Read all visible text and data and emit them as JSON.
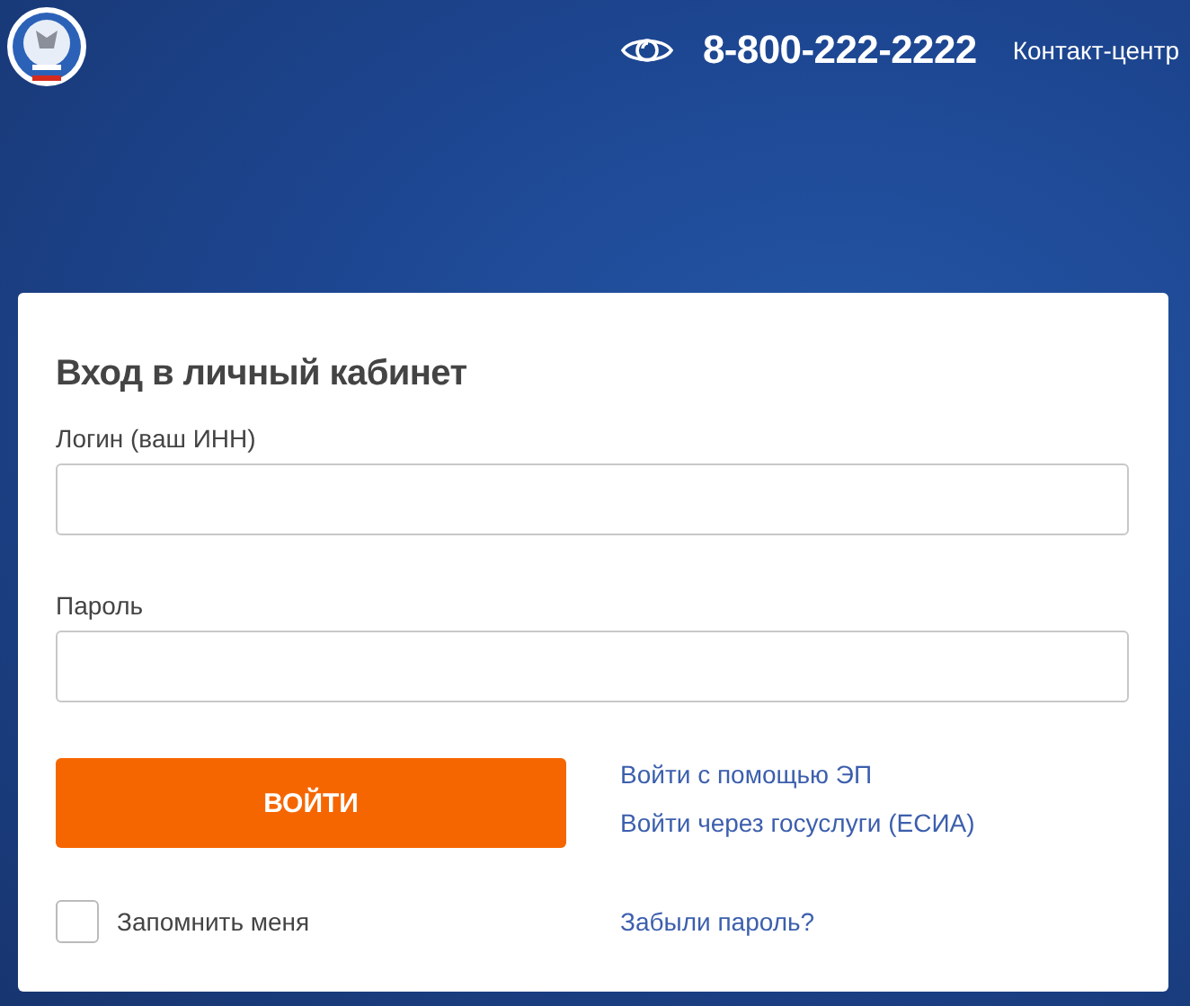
{
  "header": {
    "phone": "8-800-222-2222",
    "contact_center": "Контакт-центр"
  },
  "login": {
    "title": "Вход в личный кабинет",
    "fields": [
      {
        "label": "Логин (ваш ИНН)"
      },
      {
        "label": "Пароль"
      }
    ],
    "submit": "ВОЙТИ",
    "alt_links": [
      "Войти с помощью ЭП",
      "Войти через госуслуги (ЕСИА)"
    ],
    "remember": {
      "label": "Запомнить меня",
      "checked": false
    },
    "forgot_link": "Забыли пароль?"
  }
}
